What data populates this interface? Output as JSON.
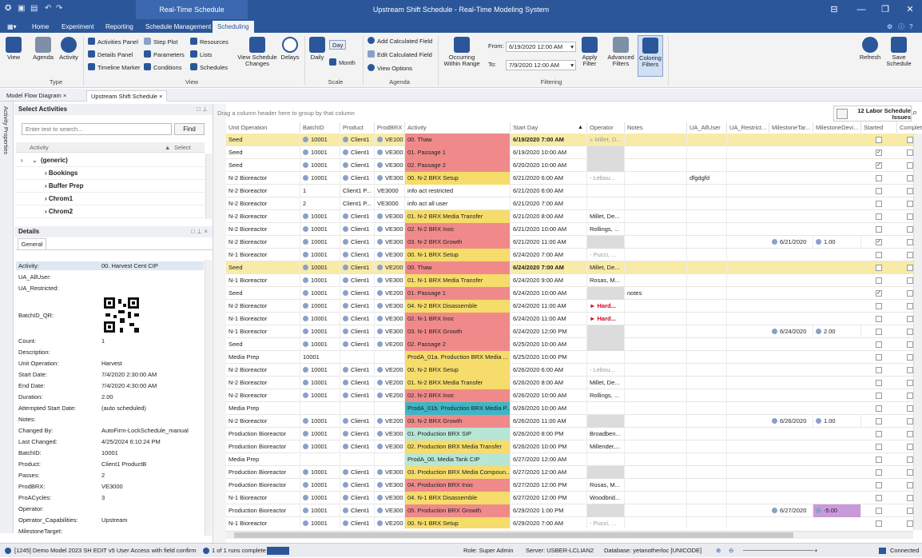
{
  "titlebar": {
    "title": "Upstream Shift Schedule - Real-Time Modeling System",
    "context_tab": "Real-Time Schedule"
  },
  "menu": [
    "Home",
    "Experiment",
    "Reporting",
    "Schedule Management",
    "Scheduling"
  ],
  "ribbon": {
    "type": {
      "view": "View",
      "agenda": "Agenda",
      "activity": "Activity",
      "label": "Type"
    },
    "view": {
      "activities_panel": "Activities Panel",
      "step_plot": "Step Plot",
      "resources": "Resources",
      "details_panel": "Details Panel",
      "parameters": "Parameters",
      "lists": "Lists",
      "timeline_marker": "Timeline Marker",
      "conditions": "Conditions",
      "schedules": "Schedules",
      "view_changes": "View Schedule Changes",
      "delays": "Delays",
      "label": "View"
    },
    "scale": {
      "daily": "Daily",
      "day": "Day",
      "month": "Month",
      "label": "Scale"
    },
    "agenda": {
      "add_calc": "Add Calculated Field",
      "edit_calc": "Edit Calculated Field",
      "view_options": "View Options",
      "label": "Agenda"
    },
    "filtering": {
      "occurring": "Occurring Within Range",
      "from_label": "From:",
      "from_value": "6/19/2020 12:00 AM",
      "to_label": "To:",
      "to_value": "7/9/2020 12:00 AM",
      "apply": "Apply Filter",
      "advanced": "Advanced Filters",
      "coloring": "Coloring Filters",
      "label": "Filtering"
    },
    "refresh": "Refresh",
    "save": "Save Schedule"
  },
  "doctabs": [
    "Model Flow Diagram",
    "Upstream Shift Schedule"
  ],
  "side_strip": "Activity Properties",
  "select_activities": {
    "title": "Select Activities",
    "search_placeholder": "Enter text to search...",
    "find": "Find",
    "col_activity": "Activity",
    "col_select": "Select",
    "items": [
      "(generic)",
      "Bookings",
      "Buffer Prep",
      "Chrom1",
      "Chrom2"
    ]
  },
  "details": {
    "title": "Details",
    "tab": "General",
    "rows": [
      {
        "k": "Activity:",
        "v": "00. Harvest Cent CIP"
      },
      {
        "k": "UA_AllUser:",
        "v": ""
      },
      {
        "k": "UA_Restricted:",
        "v": ""
      },
      {
        "k": "BatchID_QR:",
        "v": ""
      },
      {
        "k": "Count:",
        "v": "1"
      },
      {
        "k": "Description:",
        "v": ""
      },
      {
        "k": "Unit Operation:",
        "v": "Harvest"
      },
      {
        "k": "Start Date:",
        "v": "7/4/2020 2:30:00 AM"
      },
      {
        "k": "End Date:",
        "v": "7/4/2020 4:30:00 AM"
      },
      {
        "k": "Duration:",
        "v": "2.00"
      },
      {
        "k": "Attempted Start Date:",
        "v": "(auto scheduled)"
      },
      {
        "k": "Notes:",
        "v": ""
      },
      {
        "k": "Changed By:",
        "v": "AutoFirm-LockSchedule_manual"
      },
      {
        "k": "Last Changed:",
        "v": "4/25/2024 6:10:24 PM"
      },
      {
        "k": "BatchID:",
        "v": "10001"
      },
      {
        "k": "Product:",
        "v": "Client1 ProductB"
      },
      {
        "k": "Passes:",
        "v": "2"
      },
      {
        "k": "ProdBRX:",
        "v": "VE3000"
      },
      {
        "k": "ProACycles:",
        "v": "3"
      },
      {
        "k": "Operator:",
        "v": ""
      },
      {
        "k": "Operator_Capabilities:",
        "v": "Upstream"
      },
      {
        "k": "MilestoneTarget:",
        "v": ""
      }
    ]
  },
  "grid": {
    "group_hint": "Drag a column header here to group by that column",
    "issues": "12 Labor Schedule Issues",
    "columns": [
      "Unit Operation",
      "BatchID",
      "Product",
      "ProdBRX",
      "Activity",
      "Start Day",
      "Operator",
      "Notes",
      "UA_AllUser",
      "UA_Restrict...",
      "MilestoneTar...",
      "MilestoneDevi...",
      "Started",
      "Completed"
    ],
    "rows": [
      {
        "u": "Seed",
        "b": "10001",
        "p": "Client1",
        "x": "VE100",
        "a": "00. Thaw",
        "ac": "#f08a8a",
        "s": "6/19/2020 7:00 AM",
        "o": "» Millet, D...",
        "n": "",
        "ua": "",
        "mt": "",
        "md": "",
        "st": false,
        "hl": true
      },
      {
        "u": "Seed",
        "b": "10001",
        "p": "Client1",
        "x": "VE300",
        "a": "01. Passage 1",
        "ac": "#f08a8a",
        "s": "6/19/2020 10:00 AM",
        "o": "",
        "n": "",
        "ua": "",
        "mt": "",
        "md": "",
        "st": true
      },
      {
        "u": "Seed",
        "b": "10001",
        "p": "Client1",
        "x": "VE300",
        "a": "02. Passage 2",
        "ac": "#f08a8a",
        "s": "6/20/2020 10:00 AM",
        "o": "",
        "n": "",
        "ua": "",
        "mt": "",
        "md": "",
        "st": true
      },
      {
        "u": "N-2 Bioreactor",
        "b": "10001",
        "p": "Client1",
        "x": "VE300",
        "a": "00. N-2 BRX Setup",
        "ac": "#f6dc6a",
        "s": "6/21/2020 6:00 AM",
        "o": "- Lebou...",
        "n": "",
        "ua": "dfgdgfd",
        "mt": "",
        "md": "",
        "st": false
      },
      {
        "u": "N-2 Bioreactor",
        "b": "1",
        "p": "Client1 P...",
        "x": "VE3000",
        "a": "info act restricted",
        "ac": "",
        "s": "6/21/2020 6:00 AM",
        "o": "",
        "n": "",
        "ua": "",
        "mt": "",
        "md": "",
        "st": false
      },
      {
        "u": "N-2 Bioreactor",
        "b": "2",
        "p": "Client1 P...",
        "x": "VE3000",
        "a": "info act all user",
        "ac": "",
        "s": "6/21/2020 7:00 AM",
        "o": "",
        "n": "",
        "ua": "",
        "mt": "",
        "md": "",
        "st": false
      },
      {
        "u": "N-2 Bioreactor",
        "b": "10001",
        "p": "Client1",
        "x": "VE300",
        "a": "01. N-2 BRX Media Transfer",
        "ac": "#f6dc6a",
        "s": "6/21/2020 8:00 AM",
        "o": "Millet, De...",
        "n": "",
        "ua": "",
        "mt": "",
        "md": "",
        "st": false
      },
      {
        "u": "N-2 Bioreactor",
        "b": "10001",
        "p": "Client1",
        "x": "VE300",
        "a": "02. N-2 BRX Inoc",
        "ac": "#f08a8a",
        "s": "6/21/2020 10:00 AM",
        "o": "Rollings, ...",
        "n": "",
        "ua": "",
        "mt": "",
        "md": "",
        "st": false
      },
      {
        "u": "N-2 Bioreactor",
        "b": "10001",
        "p": "Client1",
        "x": "VE300",
        "a": "03. N-2 BRX Growth",
        "ac": "#f08a8a",
        "s": "6/21/2020 11:00 AM",
        "o": "",
        "n": "",
        "ua": "",
        "mt": "6/21/2020",
        "md": "1.00",
        "st": true
      },
      {
        "u": "N-1 Bioreactor",
        "b": "10001",
        "p": "Client1",
        "x": "VE300",
        "a": "00. N-1 BRX Setup",
        "ac": "#f6dc6a",
        "s": "6/24/2020 7:00 AM",
        "o": "- Pucci, ...",
        "n": "",
        "ua": "",
        "mt": "",
        "md": "",
        "st": false
      },
      {
        "u": "Seed",
        "b": "10001",
        "p": "Client1",
        "x": "VE200",
        "a": "00. Thaw",
        "ac": "#f08a8a",
        "s": "6/24/2020 7:00 AM",
        "o": "Millet, De...",
        "n": "",
        "ua": "",
        "mt": "",
        "md": "",
        "st": false,
        "hl": true
      },
      {
        "u": "N-1 Bioreactor",
        "b": "10001",
        "p": "Client1",
        "x": "VE300",
        "a": "01. N-1 BRX Media Transfer",
        "ac": "#f6dc6a",
        "s": "6/24/2020 9:00 AM",
        "o": "Rosas, M...",
        "n": "",
        "ua": "",
        "mt": "",
        "md": "",
        "st": false
      },
      {
        "u": "Seed",
        "b": "10001",
        "p": "Client1",
        "x": "VE200",
        "a": "01. Passage 1",
        "ac": "#f08a8a",
        "s": "6/24/2020 10:00 AM",
        "o": "",
        "n": "notes",
        "ua": "",
        "mt": "",
        "md": "",
        "st": true
      },
      {
        "u": "N-2 Bioreactor",
        "b": "10001",
        "p": "Client1",
        "x": "VE300",
        "a": "04. N-2 BRX Disassemble",
        "ac": "#f6dc6a",
        "s": "6/24/2020 11:00 AM",
        "o": "► Hard...",
        "n": "",
        "ua": "",
        "mt": "",
        "md": "",
        "st": false,
        "red": true
      },
      {
        "u": "N-1 Bioreactor",
        "b": "10001",
        "p": "Client1",
        "x": "VE300",
        "a": "02. N-1 BRX Inoc",
        "ac": "#f08a8a",
        "s": "6/24/2020 11:00 AM",
        "o": "► Hard...",
        "n": "",
        "ua": "",
        "mt": "",
        "md": "",
        "st": false,
        "red": true
      },
      {
        "u": "N-1 Bioreactor",
        "b": "10001",
        "p": "Client1",
        "x": "VE300",
        "a": "03. N-1 BRX Growth",
        "ac": "#f08a8a",
        "s": "6/24/2020 12:00 PM",
        "o": "",
        "n": "",
        "ua": "",
        "mt": "6/24/2020",
        "md": "2.00",
        "st": false
      },
      {
        "u": "Seed",
        "b": "10001",
        "p": "Client1",
        "x": "VE200",
        "a": "02. Passage 2",
        "ac": "#f08a8a",
        "s": "6/25/2020 10:00 AM",
        "o": "",
        "n": "",
        "ua": "",
        "mt": "",
        "md": "",
        "st": false
      },
      {
        "u": "Media Prep",
        "b": "10001",
        "p": "",
        "x": "",
        "a": "ProdA_01a. Production BRX Media ...",
        "ac": "#f6dc6a",
        "s": "6/25/2020 10:00 PM",
        "o": "",
        "n": "",
        "ua": "",
        "mt": "",
        "md": "",
        "st": false
      },
      {
        "u": "N-2 Bioreactor",
        "b": "10001",
        "p": "Client1",
        "x": "VE200",
        "a": "00. N-2 BRX Setup",
        "ac": "#f6dc6a",
        "s": "6/26/2020 6:00 AM",
        "o": "- Lebou...",
        "n": "",
        "ua": "",
        "mt": "",
        "md": "",
        "st": false
      },
      {
        "u": "N-2 Bioreactor",
        "b": "10001",
        "p": "Client1",
        "x": "VE200",
        "a": "01. N-2 BRX Media Transfer",
        "ac": "#f6dc6a",
        "s": "6/26/2020 8:00 AM",
        "o": "Millet, De...",
        "n": "",
        "ua": "",
        "mt": "",
        "md": "",
        "st": false
      },
      {
        "u": "N-2 Bioreactor",
        "b": "10001",
        "p": "Client1",
        "x": "VE200",
        "a": "02. N-2 BRX Inoc",
        "ac": "#f08a8a",
        "s": "6/26/2020 10:00 AM",
        "o": "Rollings, ...",
        "n": "",
        "ua": "",
        "mt": "",
        "md": "",
        "st": false
      },
      {
        "u": "Media Prep",
        "b": "",
        "p": "",
        "x": "",
        "a": "ProdA_01b. Production BRX Media P...",
        "ac": "#3fb6c4",
        "s": "6/26/2020 10:00 AM",
        "o": "",
        "n": "",
        "ua": "",
        "mt": "",
        "md": "",
        "st": false
      },
      {
        "u": "N-2 Bioreactor",
        "b": "10001",
        "p": "Client1",
        "x": "VE200",
        "a": "03. N-2 BRX Growth",
        "ac": "#f08a8a",
        "s": "6/26/2020 11:00 AM",
        "o": "",
        "n": "",
        "ua": "",
        "mt": "6/26/2020",
        "md": "1.00",
        "st": false
      },
      {
        "u": "Production Bioreactor",
        "b": "10001",
        "p": "Client1",
        "x": "VE300",
        "a": "01. Production BRX SIP",
        "ac": "#b8e6d6",
        "s": "6/26/2020 8:00 PM",
        "o": "Broadben...",
        "n": "",
        "ua": "",
        "mt": "",
        "md": "",
        "st": false
      },
      {
        "u": "Production Bioreactor",
        "b": "10001",
        "p": "Client1",
        "x": "VE300",
        "a": "02. Production BRX Media Transfer",
        "ac": "#f6dc6a",
        "s": "6/26/2020 10:00 PM",
        "o": "Millender,...",
        "n": "",
        "ua": "",
        "mt": "",
        "md": "",
        "st": false
      },
      {
        "u": "Media Prep",
        "b": "",
        "p": "",
        "x": "",
        "a": "ProdA_00. Media Tank CIP",
        "ac": "#b8e6d6",
        "s": "6/27/2020 12:00 AM",
        "o": "",
        "n": "",
        "ua": "",
        "mt": "",
        "md": "",
        "st": false
      },
      {
        "u": "Production Bioreactor",
        "b": "10001",
        "p": "Client1",
        "x": "VE300",
        "a": "03. Production BRX Media Compoun...",
        "ac": "#f6dc6a",
        "s": "6/27/2020 12:00 AM",
        "o": "",
        "n": "",
        "ua": "",
        "mt": "",
        "md": "",
        "st": false
      },
      {
        "u": "Production Bioreactor",
        "b": "10001",
        "p": "Client1",
        "x": "VE300",
        "a": "04. Production BRX Inoc",
        "ac": "#f08a8a",
        "s": "6/27/2020 12:00 PM",
        "o": "Rosas, M...",
        "n": "",
        "ua": "",
        "mt": "",
        "md": "",
        "st": false
      },
      {
        "u": "N-1 Bioreactor",
        "b": "10001",
        "p": "Client1",
        "x": "VE300",
        "a": "04. N-1 BRX Disassemble",
        "ac": "#f6dc6a",
        "s": "6/27/2020 12:00 PM",
        "o": "Woodbrid...",
        "n": "",
        "ua": "",
        "mt": "",
        "md": "",
        "st": false
      },
      {
        "u": "Production Bioreactor",
        "b": "10001",
        "p": "Client1",
        "x": "VE300",
        "a": "05. Production BRX Growth",
        "ac": "#f08a8a",
        "s": "6/29/2020 1:00 PM",
        "o": "",
        "n": "",
        "ua": "",
        "mt": "6/27/2020",
        "md": "-5.00",
        "st": false,
        "mdp": true
      },
      {
        "u": "N-1 Bioreactor",
        "b": "10001",
        "p": "Client1",
        "x": "VE200",
        "a": "00. N-1 BRX Setup",
        "ac": "#f6dc6a",
        "s": "6/29/2020 7:00 AM",
        "o": "- Pucci, ...",
        "n": "",
        "ua": "",
        "mt": "",
        "md": "",
        "st": false
      }
    ]
  },
  "status": {
    "model": "[1245] Demo Model 2023 SH EDIT v5 User Access with field confirm",
    "runs": "1 of 1 runs complete",
    "role": "Role: Super Admin",
    "server": "Server: USBER-LCLIAN2",
    "database": "Database: yetanotherloc [UNICODE]",
    "connected": "Connected"
  },
  "colors": {
    "brand": "#2b579a",
    "yellow": "#f6dc6a",
    "red": "#f08a8a",
    "teal": "#3fb6c4",
    "highlight": "#f8eba8"
  }
}
